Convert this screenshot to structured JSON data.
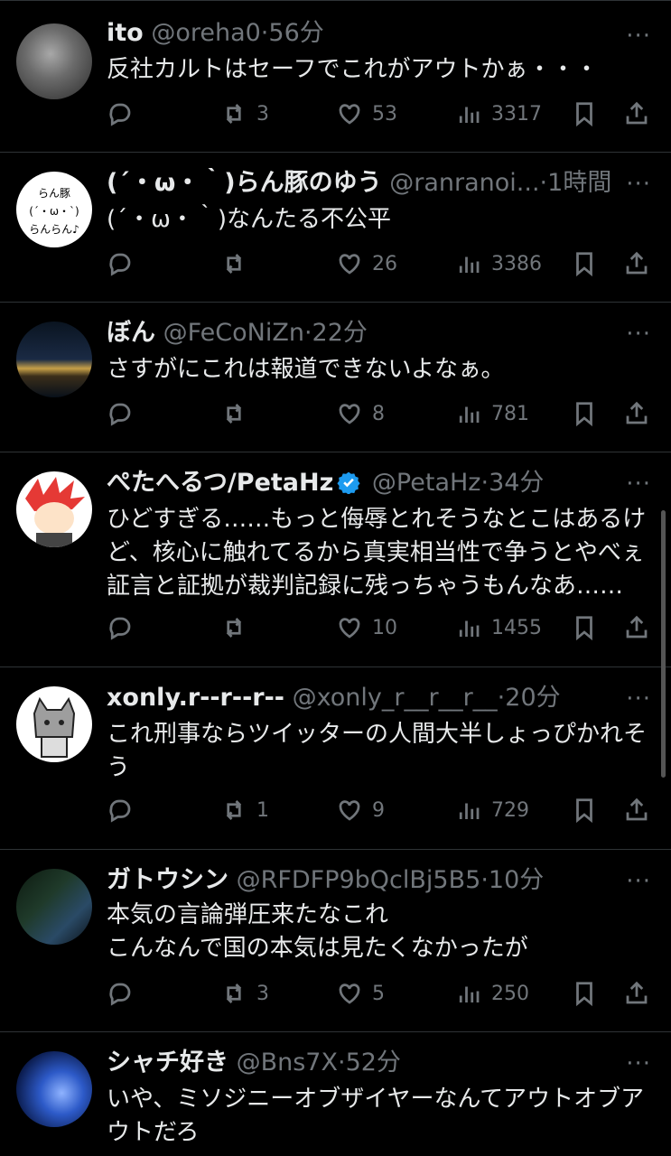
{
  "tweets": [
    {
      "name": "ito",
      "handle": "@oreha0",
      "time": "56分",
      "text": "反社カルトはセーフでこれがアウトかぁ・・・",
      "replies": "",
      "retweets": "3",
      "likes": "53",
      "views": "3317",
      "avatar_colors": [
        "#4a4a4a",
        "#9a9a9a"
      ]
    },
    {
      "name": "(´・ω・｀)らん豚のゆう",
      "handle": "@ranranoi...",
      "time": "1時間",
      "text": "(´・ω・｀)なんたる不公平",
      "replies": "",
      "retweets": "",
      "likes": "26",
      "views": "3386",
      "avatar_text": [
        "らん豚",
        "(´・ω・`)",
        "らんらん♪"
      ]
    },
    {
      "name": "ぼん",
      "handle": "@FeCoNiZn",
      "time": "22分",
      "text": "さすがにこれは報道できないよなぁ。",
      "replies": "",
      "retweets": "",
      "likes": "8",
      "views": "781",
      "avatar_colors": [
        "#0c1b2d",
        "#c9a24a"
      ]
    },
    {
      "name": "ぺたへるつ/PetaHz",
      "handle": "@PetaHz",
      "time": "34分",
      "text": "ひどすぎる……もっと侮辱とれそうなとこはあるけど、核心に触れてるから真実相当性で争うとやべぇ証言と証拠が裁判記録に残っちゃうもんなあ……",
      "replies": "",
      "retweets": "",
      "likes": "10",
      "views": "1455",
      "verified": true,
      "avatar_colors": [
        "#ffffff",
        "#e53935"
      ]
    },
    {
      "name": "xonly.r--r--r--",
      "handle": "@xonly_r__r__r__",
      "time": "20分",
      "text": "これ刑事ならツイッターの人間大半しょっぴかれそう",
      "replies": "",
      "retweets": "1",
      "likes": "9",
      "views": "729",
      "avatar_colors": [
        "#ffffff",
        "#888888"
      ]
    },
    {
      "name": "ガトウシン",
      "handle": "@RFDFP9bQclBj5B5",
      "time": "10分",
      "text": "本気の言論弾圧来たなこれ\nこんなんで国の本気は見たくなかったが",
      "replies": "",
      "retweets": "3",
      "likes": "5",
      "views": "250",
      "avatar_colors": [
        "#1a2a1a",
        "#3a6a8a"
      ]
    },
    {
      "name": "シャチ好き",
      "handle": "@Bns7X",
      "time": "52分",
      "text": "いや、ミソジニーオブザイヤーなんてアウトオブアウトだろ",
      "replies": "",
      "retweets": "",
      "likes": "",
      "views": "",
      "avatar_colors": [
        "#0a1a4a",
        "#4a7ad0"
      ]
    }
  ],
  "ui": {
    "more": "···",
    "dot": "·"
  },
  "colors": {
    "verified": "#1d9bf0",
    "muted": "#71767b",
    "text": "#e7e9ea",
    "divider": "#2f3336"
  }
}
